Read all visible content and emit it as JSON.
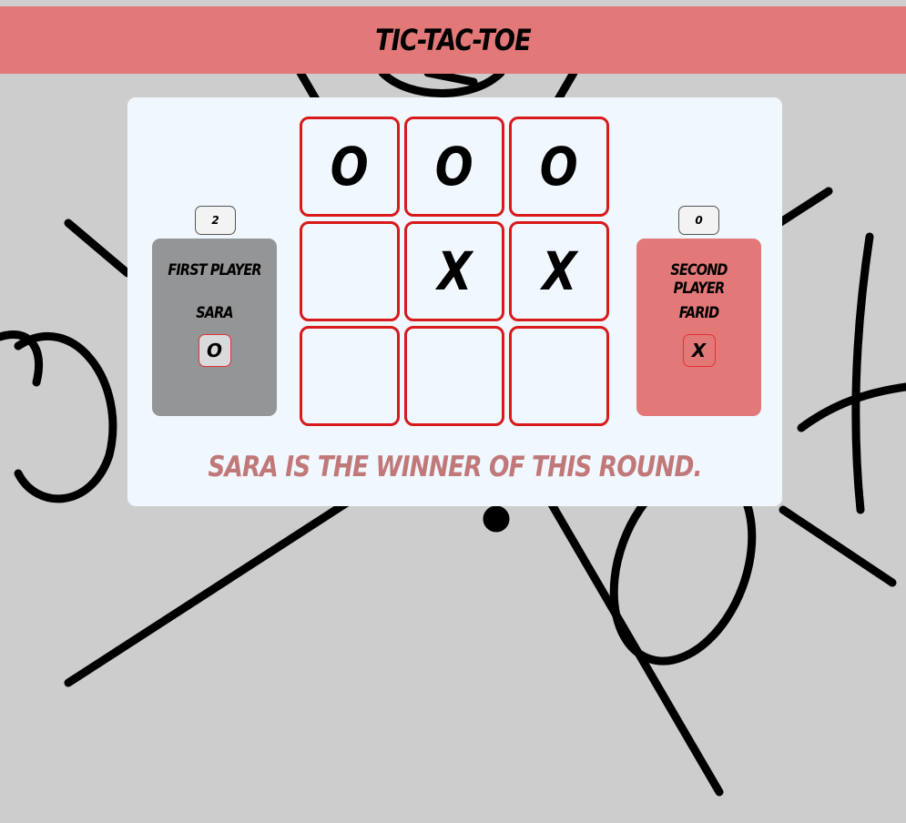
{
  "header": {
    "title": "TIC-TAC-TOE"
  },
  "players": [
    {
      "label": "FIRST PLAYER",
      "name": "SARA",
      "mark": "O",
      "score": "2",
      "color": "#949596"
    },
    {
      "label": "SECOND PLAYER",
      "name": "FARID",
      "mark": "X",
      "score": "0",
      "color": "#e37878"
    }
  ],
  "board": {
    "cells": [
      "O",
      "O",
      "O",
      "",
      "X",
      "X",
      "",
      "",
      ""
    ]
  },
  "status": {
    "message": "SARA IS THE WINNER OF THIS ROUND."
  },
  "colors": {
    "header": "#e37878",
    "cell_border": "#d81a1a",
    "panel": "#f1f7fe",
    "message": "#c07878"
  }
}
